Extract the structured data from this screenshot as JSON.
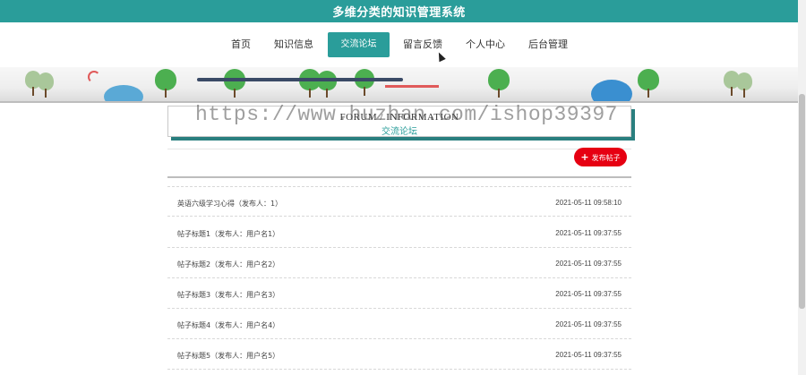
{
  "header": {
    "title": "多维分类的知识管理系统"
  },
  "nav": {
    "items": [
      {
        "label": "首页"
      },
      {
        "label": "知识信息"
      },
      {
        "label": "交流论坛"
      },
      {
        "label": "留言反馈"
      },
      {
        "label": "个人中心"
      },
      {
        "label": "后台管理"
      }
    ],
    "active_index": 2
  },
  "section": {
    "title_en": "FORUM / INFORMATION",
    "title_zh": "交流论坛"
  },
  "watermark": "https://www.huzhan.com/ishop39397",
  "actions": {
    "publish_label": "发布帖子",
    "publish_icon": "plus-icon"
  },
  "posts": [
    {
      "title": "英语六级学习心得（发布人：1）",
      "date": "2021-05-11 09:58:10"
    },
    {
      "title": "帖子标题1（发布人：用户名1）",
      "date": "2021-05-11 09:37:55"
    },
    {
      "title": "帖子标题2（发布人：用户名2）",
      "date": "2021-05-11 09:37:55"
    },
    {
      "title": "帖子标题3（发布人：用户名3）",
      "date": "2021-05-11 09:37:55"
    },
    {
      "title": "帖子标题4（发布人：用户名4）",
      "date": "2021-05-11 09:37:55"
    },
    {
      "title": "帖子标题5（发布人：用户名5）",
      "date": "2021-05-11 09:37:55"
    }
  ],
  "colors": {
    "accent": "#2a9d9a",
    "button": "#e60012",
    "tree": "#4caf50"
  }
}
